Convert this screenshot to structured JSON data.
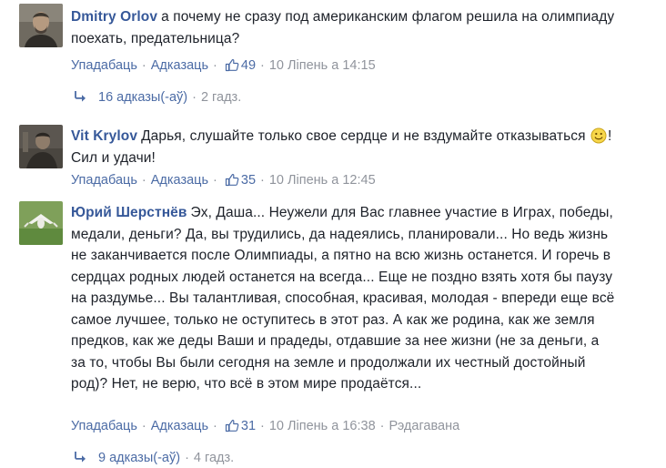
{
  "comments": [
    {
      "author": "Dmitry Orlov",
      "text": "а почему не сразу под американским флагом решила на олимпиаду поехать, предательница?",
      "like_label": "Упадабаць",
      "reply_label": "Адказаць",
      "likes": "49",
      "timestamp": "10 Лiпень а 14:15",
      "replies_label": "16 адказы(-аў)",
      "replies_time": "2 гадз."
    },
    {
      "author": "Vit Krylov",
      "text_before": "Дарья, слушайте только свое сердце и не вздумайте отказываться",
      "text_after": "! Сил и удачи!",
      "like_label": "Упадабаць",
      "reply_label": "Адказаць",
      "likes": "35",
      "timestamp": "10 Лiпень а 12:45"
    },
    {
      "author": "Юрий Шерстнёв",
      "text": "Эх, Даша... Неужели для Вас главнее участие в Играх, победы, медали, деньги? Да, вы трудились, да надеялись, планировали... Но ведь жизнь не заканчивается после Олимпиады, а пятно на всю жизнь останется. И горечь в сердцах родных людей останется на всегда... Еще не поздно взять хотя бы паузу на раздумье... Вы талантливая, способная, красивая, молодая - впереди еще всё самое лучшее, только не оступитесь в этот раз. А как же родина, как же земля предков, как же деды Ваши и прадеды, отдавшие за нее жизни (не за деньги, а за то, чтобы Вы были сегодня на земле и продолжали их честный достойный род)? Нет, не верю, что всё в этом мире продаётся...",
      "like_label": "Упадабаць",
      "reply_label": "Адказаць",
      "likes": "31",
      "timestamp": "10 Лiпень а 16:38",
      "edited_label": "Рэдагавана",
      "replies_label": "9 адказы(-аў)",
      "replies_time": "4 гадз."
    }
  ],
  "icons": {
    "like": "thumbs-up-icon",
    "reply_arrow": "reply-arrow-icon",
    "smiley": "smiley-icon"
  },
  "colors": {
    "author": "#365899",
    "link": "#4b6ba5",
    "meta": "#90949c",
    "text": "#1d2129"
  }
}
